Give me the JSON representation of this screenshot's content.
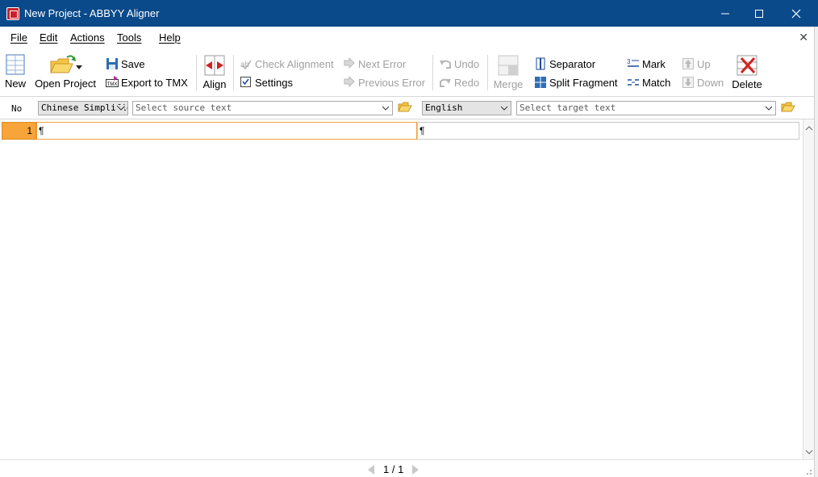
{
  "window": {
    "title": "New Project - ABBYY Aligner",
    "app_icon": "abbyy-aligner-icon",
    "accent_color": "#0b4a8a"
  },
  "menu": [
    "File",
    "Edit",
    "Actions",
    "Tools",
    "Help"
  ],
  "toolbar": {
    "new_label": "New",
    "open_label": "Open Project",
    "save_label": "Save",
    "export_label": "Export to TMX",
    "align_label": "Align",
    "check_label": "Check Alignment",
    "settings_label": "Settings",
    "next_error_label": "Next Error",
    "prev_error_label": "Previous Error",
    "undo_label": "Undo",
    "redo_label": "Redo",
    "merge_label": "Merge",
    "separator_label": "Separator",
    "split_label": "Split Fragment",
    "mark_label": "Mark",
    "match_label": "Match",
    "up_label": "Up",
    "down_label": "Down",
    "delete_label": "Delete"
  },
  "langbar": {
    "no_label": "No",
    "source_language": "Chinese Simplified",
    "source_placeholder": "Select source text",
    "target_language": "English",
    "target_placeholder": "Select target text"
  },
  "rows": [
    {
      "number": "1",
      "source": "¶",
      "target": "¶"
    }
  ],
  "status": {
    "page": "1 / 1"
  }
}
